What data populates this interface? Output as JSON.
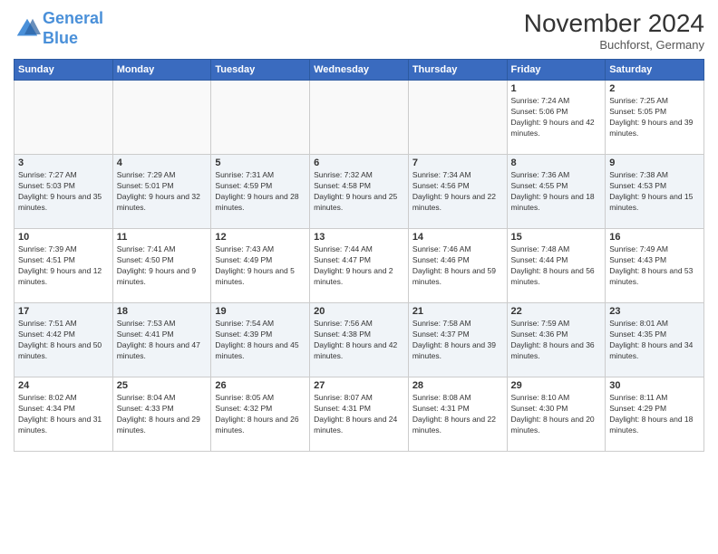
{
  "logo": {
    "line1": "General",
    "line2": "Blue"
  },
  "title": "November 2024",
  "location": "Buchforst, Germany",
  "days_of_week": [
    "Sunday",
    "Monday",
    "Tuesday",
    "Wednesday",
    "Thursday",
    "Friday",
    "Saturday"
  ],
  "weeks": [
    [
      {
        "day": "",
        "info": ""
      },
      {
        "day": "",
        "info": ""
      },
      {
        "day": "",
        "info": ""
      },
      {
        "day": "",
        "info": ""
      },
      {
        "day": "",
        "info": ""
      },
      {
        "day": "1",
        "info": "Sunrise: 7:24 AM\nSunset: 5:06 PM\nDaylight: 9 hours and 42 minutes."
      },
      {
        "day": "2",
        "info": "Sunrise: 7:25 AM\nSunset: 5:05 PM\nDaylight: 9 hours and 39 minutes."
      }
    ],
    [
      {
        "day": "3",
        "info": "Sunrise: 7:27 AM\nSunset: 5:03 PM\nDaylight: 9 hours and 35 minutes."
      },
      {
        "day": "4",
        "info": "Sunrise: 7:29 AM\nSunset: 5:01 PM\nDaylight: 9 hours and 32 minutes."
      },
      {
        "day": "5",
        "info": "Sunrise: 7:31 AM\nSunset: 4:59 PM\nDaylight: 9 hours and 28 minutes."
      },
      {
        "day": "6",
        "info": "Sunrise: 7:32 AM\nSunset: 4:58 PM\nDaylight: 9 hours and 25 minutes."
      },
      {
        "day": "7",
        "info": "Sunrise: 7:34 AM\nSunset: 4:56 PM\nDaylight: 9 hours and 22 minutes."
      },
      {
        "day": "8",
        "info": "Sunrise: 7:36 AM\nSunset: 4:55 PM\nDaylight: 9 hours and 18 minutes."
      },
      {
        "day": "9",
        "info": "Sunrise: 7:38 AM\nSunset: 4:53 PM\nDaylight: 9 hours and 15 minutes."
      }
    ],
    [
      {
        "day": "10",
        "info": "Sunrise: 7:39 AM\nSunset: 4:51 PM\nDaylight: 9 hours and 12 minutes."
      },
      {
        "day": "11",
        "info": "Sunrise: 7:41 AM\nSunset: 4:50 PM\nDaylight: 9 hours and 9 minutes."
      },
      {
        "day": "12",
        "info": "Sunrise: 7:43 AM\nSunset: 4:49 PM\nDaylight: 9 hours and 5 minutes."
      },
      {
        "day": "13",
        "info": "Sunrise: 7:44 AM\nSunset: 4:47 PM\nDaylight: 9 hours and 2 minutes."
      },
      {
        "day": "14",
        "info": "Sunrise: 7:46 AM\nSunset: 4:46 PM\nDaylight: 8 hours and 59 minutes."
      },
      {
        "day": "15",
        "info": "Sunrise: 7:48 AM\nSunset: 4:44 PM\nDaylight: 8 hours and 56 minutes."
      },
      {
        "day": "16",
        "info": "Sunrise: 7:49 AM\nSunset: 4:43 PM\nDaylight: 8 hours and 53 minutes."
      }
    ],
    [
      {
        "day": "17",
        "info": "Sunrise: 7:51 AM\nSunset: 4:42 PM\nDaylight: 8 hours and 50 minutes."
      },
      {
        "day": "18",
        "info": "Sunrise: 7:53 AM\nSunset: 4:41 PM\nDaylight: 8 hours and 47 minutes."
      },
      {
        "day": "19",
        "info": "Sunrise: 7:54 AM\nSunset: 4:39 PM\nDaylight: 8 hours and 45 minutes."
      },
      {
        "day": "20",
        "info": "Sunrise: 7:56 AM\nSunset: 4:38 PM\nDaylight: 8 hours and 42 minutes."
      },
      {
        "day": "21",
        "info": "Sunrise: 7:58 AM\nSunset: 4:37 PM\nDaylight: 8 hours and 39 minutes."
      },
      {
        "day": "22",
        "info": "Sunrise: 7:59 AM\nSunset: 4:36 PM\nDaylight: 8 hours and 36 minutes."
      },
      {
        "day": "23",
        "info": "Sunrise: 8:01 AM\nSunset: 4:35 PM\nDaylight: 8 hours and 34 minutes."
      }
    ],
    [
      {
        "day": "24",
        "info": "Sunrise: 8:02 AM\nSunset: 4:34 PM\nDaylight: 8 hours and 31 minutes."
      },
      {
        "day": "25",
        "info": "Sunrise: 8:04 AM\nSunset: 4:33 PM\nDaylight: 8 hours and 29 minutes."
      },
      {
        "day": "26",
        "info": "Sunrise: 8:05 AM\nSunset: 4:32 PM\nDaylight: 8 hours and 26 minutes."
      },
      {
        "day": "27",
        "info": "Sunrise: 8:07 AM\nSunset: 4:31 PM\nDaylight: 8 hours and 24 minutes."
      },
      {
        "day": "28",
        "info": "Sunrise: 8:08 AM\nSunset: 4:31 PM\nDaylight: 8 hours and 22 minutes."
      },
      {
        "day": "29",
        "info": "Sunrise: 8:10 AM\nSunset: 4:30 PM\nDaylight: 8 hours and 20 minutes."
      },
      {
        "day": "30",
        "info": "Sunrise: 8:11 AM\nSunset: 4:29 PM\nDaylight: 8 hours and 18 minutes."
      }
    ]
  ]
}
